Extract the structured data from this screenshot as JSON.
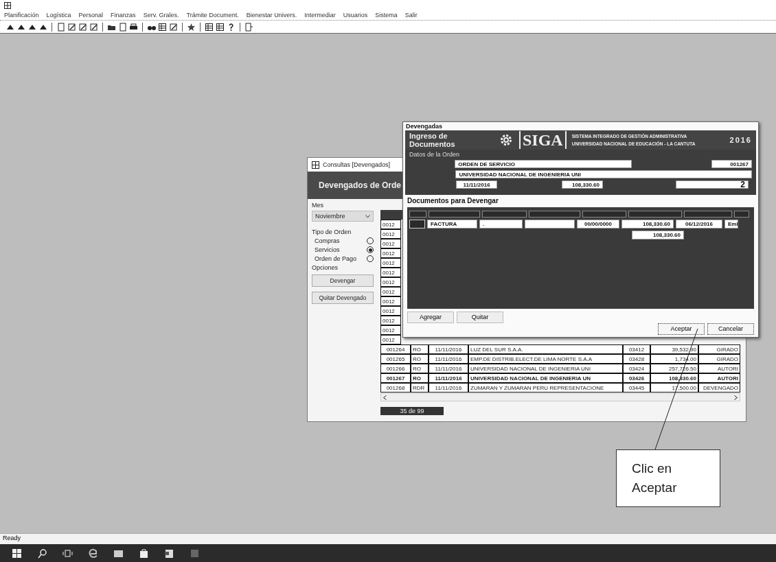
{
  "menu": [
    "Planificación",
    "Logística",
    "Personal",
    "Finanzas",
    "Serv. Grales.",
    "Trámite Document.",
    "Bienestar Univers.",
    "Intermediar",
    "Usuarios",
    "Sistema",
    "Salir"
  ],
  "back_window": {
    "title": "Consultas [Devengados]",
    "header": "Devengados de Orde",
    "month_label": "Mes",
    "month": "Noviembre",
    "order_type_label": "Tipo de Orden",
    "order_types": [
      {
        "label": "Compras",
        "selected": false
      },
      {
        "label": "Servicios",
        "selected": true
      },
      {
        "label": "Orden de Pago",
        "selected": false
      }
    ],
    "options_label": "Opciones",
    "buttons": [
      "Devengar",
      "Quitar Devengado"
    ],
    "covered_rows": [
      "0012",
      "0012",
      "0012",
      "0012",
      "0012",
      "0012",
      "0012",
      "0012",
      "0012",
      "0012",
      "0012",
      "0012",
      "0012"
    ],
    "rows": [
      {
        "cells": [
          "001264",
          "RO",
          "11/11/2016",
          "LUZ DEL SUR S.A.A.",
          "03412",
          "39,532.90",
          "GIRADO"
        ],
        "selected": false
      },
      {
        "cells": [
          "001265",
          "RO",
          "11/11/2016",
          "EMP.DE DISTRIB.ELECT.DE LIMA NORTE S.A.A",
          "03428",
          "1,734.00",
          "GIRADO"
        ],
        "selected": false
      },
      {
        "cells": [
          "001266",
          "RO",
          "11/11/2016",
          "UNIVERSIDAD NACIONAL DE INGENIERIA UNI",
          "03424",
          "257,726.50",
          "AUTORI"
        ],
        "selected": false
      },
      {
        "cells": [
          "001267",
          "RO",
          "11/11/2016",
          "UNIVERSIDAD NACIONAL DE INGENIERIA UN",
          "03426",
          "108,330.60",
          "AUTORI"
        ],
        "selected": true
      },
      {
        "cells": [
          "001268",
          "RDR",
          "11/11/2016",
          "ZUMARAN Y ZUMARAN PERU REPRESENTACIONE",
          "03445",
          "17,500.00",
          "DEVENGADO"
        ],
        "selected": false
      }
    ],
    "record_count": "35 de 99"
  },
  "dialog": {
    "title": "Devengadas",
    "banner_title": "Ingreso de Documentos",
    "logo": "SIGA",
    "system_name": "SISTEMA INTEGRADO DE GESTIÓN ADMINISTRATIVA",
    "institution": "UNIVERSIDAD NACIONAL DE EDUCACIÓN - LA CANTUTA",
    "year": "2016",
    "section_label": "Datos de la Orden",
    "order_type": "ORDEN DE SERVICIO",
    "order_number": "001267",
    "supplier": "UNIVERSIDAD NACIONAL DE INGENIERIA UNI",
    "date": "11/11/2016",
    "amount": "108,330.60",
    "count": "2",
    "group_label": "Documentos para Devengar",
    "doc_row": {
      "type": "FACTURA",
      "column_2": ".",
      "date": "00/00/0000",
      "amount": "108,330.60",
      "due_date": "06/12/2016",
      "column_7": "Eml"
    },
    "total": "108,330.60",
    "grid_buttons": [
      "Agregar",
      "Quitar"
    ],
    "accept": "Aceptar",
    "cancel": "Cancelar"
  },
  "callout": "Clic en Aceptar",
  "status_bar": "Ready"
}
